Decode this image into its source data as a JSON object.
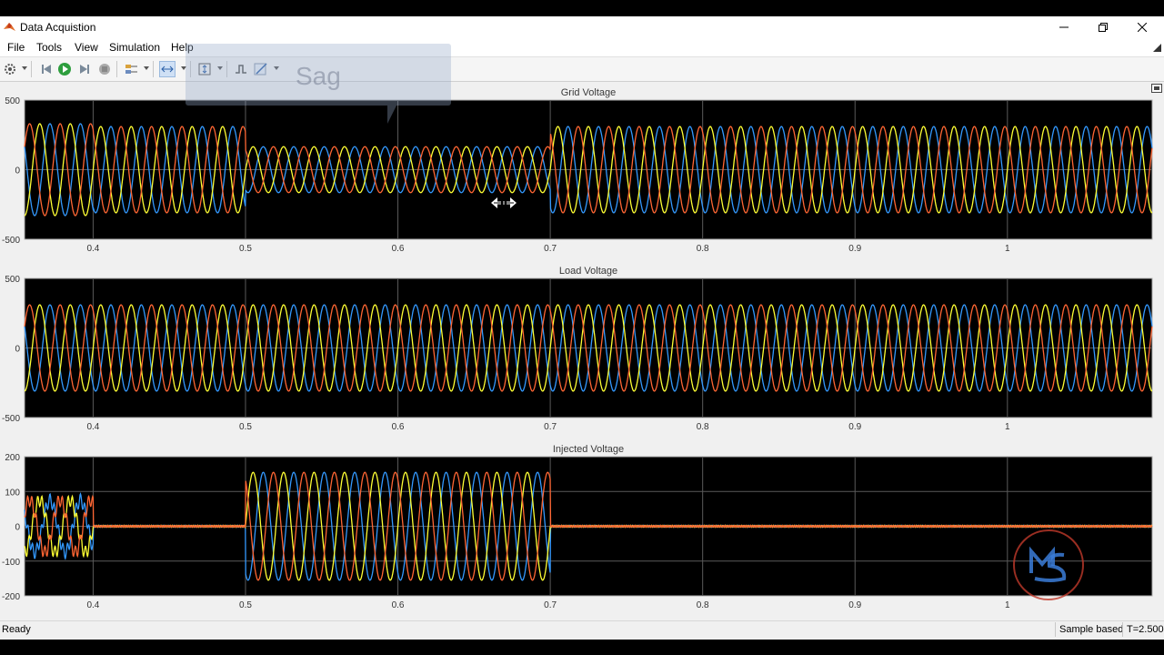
{
  "window": {
    "title": "Data  Acquistion"
  },
  "menu": [
    "File",
    "Tools",
    "View",
    "Simulation",
    "Help"
  ],
  "annotation": {
    "text": "Sag"
  },
  "status": {
    "left": "Ready",
    "mode": "Sample based",
    "time": "T=2.500"
  },
  "colors": {
    "plot_bg": "#000000",
    "phase_a": "#ffff33",
    "phase_b": "#3399ff",
    "phase_c": "#ff6633",
    "axis": "#cfcfcf",
    "grid": "#5a5a5a"
  },
  "chart_data": [
    {
      "type": "line",
      "title": "Grid Voltage",
      "xlim": [
        0.355,
        1.095
      ],
      "ylim": [
        -500,
        500
      ],
      "x_ticks": [
        0.4,
        0.5,
        0.6,
        0.7,
        0.8,
        0.9,
        1
      ],
      "x_tick_labels": [
        "0.4",
        "0.5",
        "0.6",
        "0.7",
        "0.8",
        "0.9",
        "1"
      ],
      "y_ticks": [
        -500,
        0,
        500
      ],
      "y_tick_labels": [
        "-500",
        "0",
        "500"
      ],
      "frequency_hz": 50,
      "series": [
        {
          "color": "#ffff33"
        },
        {
          "color": "#3399ff"
        },
        {
          "color": "#ff6633"
        }
      ],
      "segments": [
        {
          "from": 0.355,
          "to": 0.4,
          "amplitude": 330
        },
        {
          "from": 0.4,
          "to": 0.5,
          "amplitude": 310
        },
        {
          "from": 0.5,
          "to": 0.7,
          "amplitude": 165
        },
        {
          "from": 0.7,
          "to": 1.095,
          "amplitude": 310
        }
      ]
    },
    {
      "type": "line",
      "title": "Load Voltage",
      "xlim": [
        0.355,
        1.095
      ],
      "ylim": [
        -500,
        500
      ],
      "x_ticks": [
        0.4,
        0.5,
        0.6,
        0.7,
        0.8,
        0.9,
        1
      ],
      "x_tick_labels": [
        "0.4",
        "0.5",
        "0.6",
        "0.7",
        "0.8",
        "0.9",
        "1"
      ],
      "y_ticks": [
        -500,
        0,
        500
      ],
      "y_tick_labels": [
        "-500",
        "0",
        "500"
      ],
      "frequency_hz": 50,
      "series": [
        {
          "color": "#ffff33"
        },
        {
          "color": "#3399ff"
        },
        {
          "color": "#ff6633"
        }
      ],
      "segments": [
        {
          "from": 0.355,
          "to": 1.095,
          "amplitude": 310
        }
      ]
    },
    {
      "type": "line",
      "title": "Injected Voltage",
      "xlim": [
        0.355,
        1.095
      ],
      "ylim": [
        -200,
        200
      ],
      "x_ticks": [
        0.4,
        0.5,
        0.6,
        0.7,
        0.8,
        0.9,
        1
      ],
      "x_tick_labels": [
        "0.4",
        "0.5",
        "0.6",
        "0.7",
        "0.8",
        "0.9",
        "1"
      ],
      "y_ticks": [
        -200,
        -100,
        0,
        100,
        200
      ],
      "y_tick_labels": [
        "-200",
        "-100",
        "0",
        "100",
        "200"
      ],
      "frequency_hz": 50,
      "series": [
        {
          "color": "#ffff33"
        },
        {
          "color": "#3399ff"
        },
        {
          "color": "#ff6633"
        }
      ],
      "segments": [
        {
          "from": 0.355,
          "to": 0.4,
          "amplitude": 75,
          "noisy": true
        },
        {
          "from": 0.4,
          "to": 0.5,
          "amplitude": 0
        },
        {
          "from": 0.5,
          "to": 0.7,
          "amplitude": 155
        },
        {
          "from": 0.7,
          "to": 1.095,
          "amplitude": 0
        }
      ]
    }
  ]
}
